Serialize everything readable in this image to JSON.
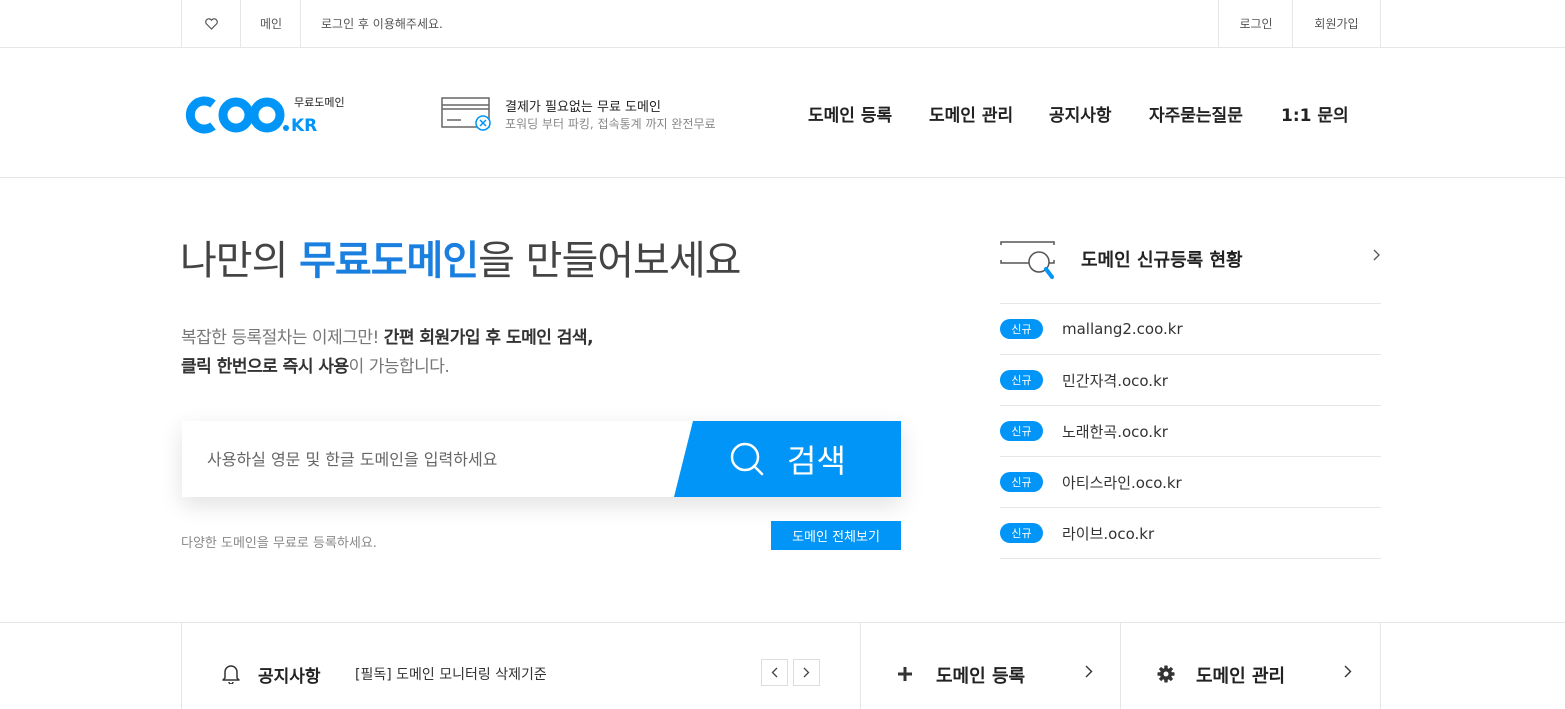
{
  "topbar": {
    "home": "메인",
    "login_msg": "로그인 후 이용해주세요.",
    "login": "로그인",
    "join": "회원가입"
  },
  "header": {
    "logo_main": "COO.KR",
    "logo_sub": "무료도메인",
    "promo_title": "결제가 필요없는 무료 도메인",
    "promo_desc": "포워딩 부터 파킹, 접속통계 까지 완전무료",
    "nav": [
      "도메인 등록",
      "도메인 관리",
      "공지사항",
      "자주묻는질문",
      "1:1 문의"
    ]
  },
  "hero": {
    "title_pre": "나만의 ",
    "title_hl": "무료도메인",
    "title_post": "을 만들어보세요",
    "desc1_pre": "복잡한 등록절차는 이제그만! ",
    "desc1_bold": "간편 회원가입 후 도메인 검색,",
    "desc2_bold": "클릭 한번으로 즉시 사용",
    "desc2_post": "이 가능합니다.",
    "search_placeholder": "사용하실 영문 및 한글 도메인을 입력하세요",
    "search_button": "검색",
    "note": "다양한 도메인을 무료로 등록하세요.",
    "view_all": "도메인 전체보기"
  },
  "registrations": {
    "title": "도메인 신규등록 현황",
    "items": [
      {
        "badge": "신규",
        "domain": "mallang2.coo.kr"
      },
      {
        "badge": "신규",
        "domain": "민간자격.oco.kr"
      },
      {
        "badge": "신규",
        "domain": "노래한곡.oco.kr"
      },
      {
        "badge": "신규",
        "domain": "아티스라인.oco.kr"
      },
      {
        "badge": "신규",
        "domain": "라이브.oco.kr"
      }
    ]
  },
  "bottom": {
    "notice_label": "공지사항",
    "notice_text": "[필독] 도메인 모니터링 삭제기준",
    "register": "도메인 등록",
    "manage": "도메인 관리"
  },
  "colors": {
    "accent": "#0095f6",
    "highlight": "#1a7fdf"
  },
  "icons": [
    "heart-icon",
    "card-icon",
    "magnifier-window-icon",
    "search-icon",
    "bell-icon",
    "plus-icon",
    "gear-icon",
    "chevron-right-icon",
    "chevron-left-icon"
  ]
}
